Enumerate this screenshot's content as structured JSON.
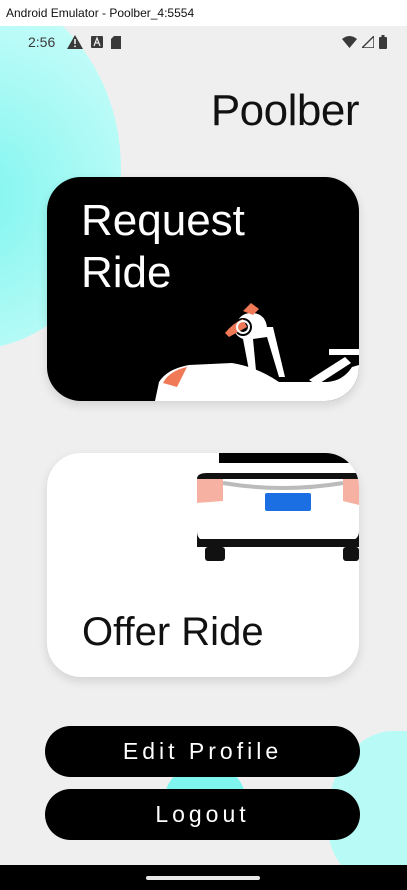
{
  "window": {
    "title": "Android Emulator - Poolber_4:5554"
  },
  "status_bar": {
    "time": "2:56",
    "left_icons": [
      "warning-icon",
      "a-badge-icon",
      "sd-card-icon"
    ],
    "right_icons": [
      "wifi-icon",
      "signal-icon",
      "battery-icon"
    ]
  },
  "app": {
    "title": "Poolber"
  },
  "cards": {
    "request": {
      "label": "Request\nRide",
      "art": "car-with-person-icon"
    },
    "offer": {
      "label": "Offer Ride",
      "art": "car-rear-icon"
    }
  },
  "buttons": {
    "edit_profile": "Edit Profile",
    "logout": "Logout"
  },
  "colors": {
    "accent_cyan": "#7ff5ef",
    "card_dark": "#000000",
    "button": "#000000",
    "background": "#efefef",
    "taillight": "#f4a79a",
    "plate": "#1b6fe3"
  }
}
